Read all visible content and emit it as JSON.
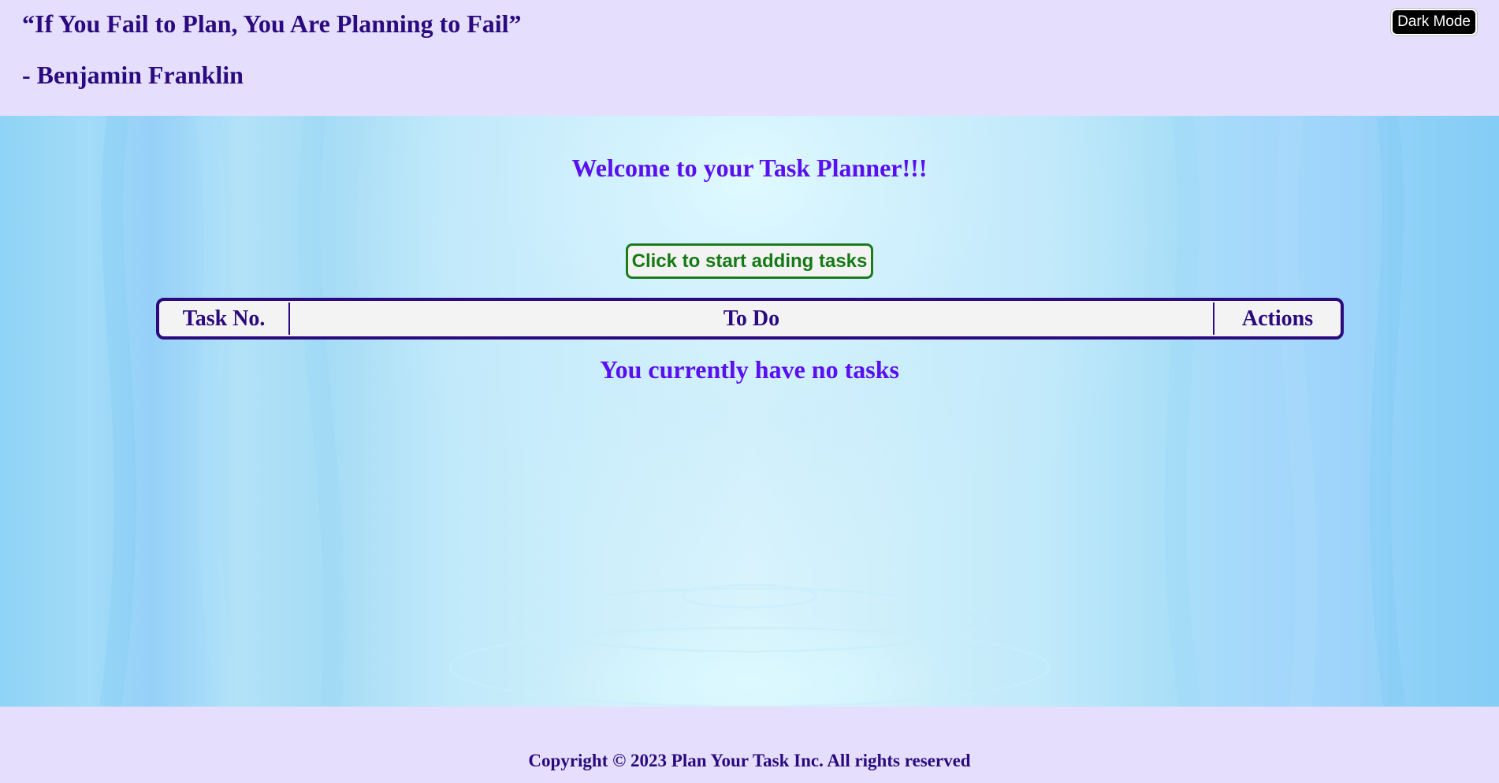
{
  "header": {
    "quote": "“If You Fail to Plan, You Are Planning to Fail”",
    "author": "- Benjamin Franklin",
    "dark_mode_label": "Dark Mode"
  },
  "main": {
    "welcome": "Welcome to your Task Planner!!!",
    "add_tasks_label": "Click to start adding tasks",
    "table": {
      "columns": [
        "Task No.",
        "To Do",
        "Actions"
      ]
    },
    "empty_message": "You currently have no tasks"
  },
  "footer": {
    "copyright": "Copyright © 2023 Plan Your Task Inc. All rights reserved"
  },
  "colors": {
    "header_bg": "#e5dffd",
    "heading_text": "#2a0a7e",
    "accent_purple": "#5a0ff0",
    "add_button_green": "#1d7a1d"
  }
}
